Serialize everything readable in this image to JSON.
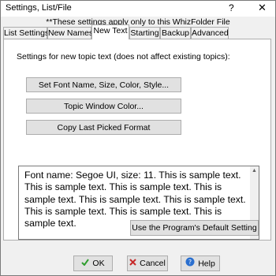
{
  "window": {
    "title": "Settings, List/File",
    "help_glyph": "?",
    "close_glyph": "✕"
  },
  "note": "**These settings apply only to this WhizFolder File",
  "tabs": [
    {
      "label": "List Settings",
      "active": false
    },
    {
      "label": "New Names",
      "active": false
    },
    {
      "label": "New Text",
      "active": true
    },
    {
      "label": "Starting",
      "active": false
    },
    {
      "label": "Backup",
      "active": false
    },
    {
      "label": "Advanced",
      "active": false
    }
  ],
  "panel": {
    "label": "Settings for new topic text (does not affect existing topics):",
    "buttons": {
      "font": "Set Font Name, Size, Color, Style...",
      "window_color": "Topic Window Color...",
      "copy_format": "Copy Last Picked Format"
    },
    "sample_text": "Font name: Segoe UI, size: 11. This is sample text. This is sample text. This is sample text. This is sample text. This is sample text. This is sample text. This is sample text. This is sample text. This is sample text.",
    "default_button": "Use the Program's Default Setting"
  },
  "footer": {
    "ok": "OK",
    "cancel": "Cancel",
    "help": "Help"
  },
  "colors": {
    "ok_check": "#2f9e2f",
    "cancel_x": "#c62828",
    "help_circle": "#2a6fcf"
  },
  "icons": {
    "ok": "check-icon",
    "cancel": "x-icon",
    "help": "question-circle-icon",
    "scroll_up": "arrow-up-icon",
    "scroll_down": "arrow-down-icon"
  }
}
